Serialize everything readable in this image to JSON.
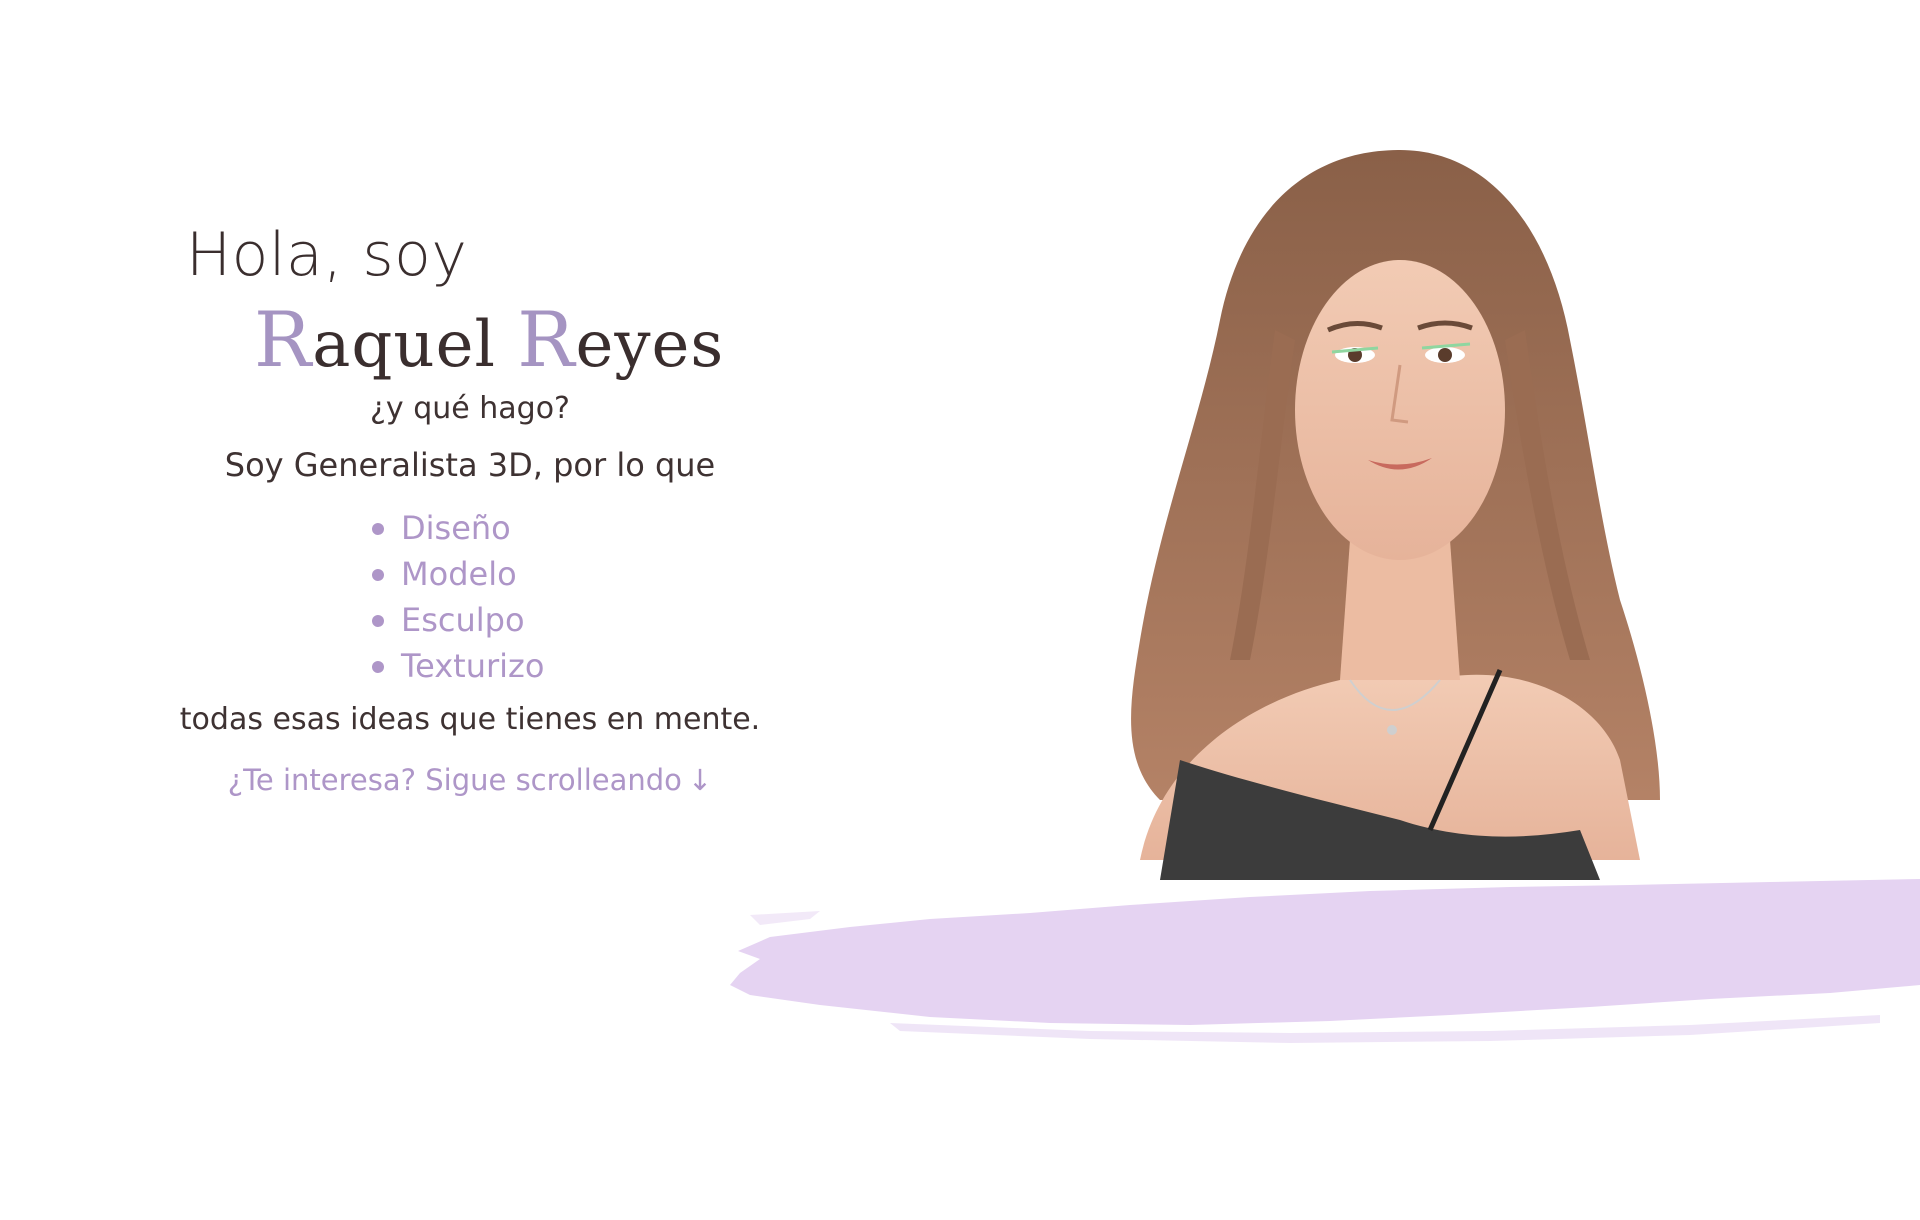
{
  "intro": {
    "greeting": "Hola, soy",
    "name": {
      "first_initial": "R",
      "first_rest": "aquel",
      "last_initial": "R",
      "last_rest": "eyes"
    },
    "question": "¿y qué hago?",
    "role": "Soy Generalista 3D, por lo que",
    "skills": [
      "Diseño",
      "Modelo",
      "Esculpo",
      "Texturizo"
    ],
    "closing": "todas esas ideas que tienes en mente.",
    "scroll_hint": "¿Te interesa? Sigue scrolleando",
    "scroll_icon": "arrow-down-icon",
    "scroll_glyph": "↓"
  },
  "colors": {
    "accent": "#ae96c8",
    "text": "#3e3232",
    "brush": "#e5d3f2",
    "background": "#ffffff"
  }
}
